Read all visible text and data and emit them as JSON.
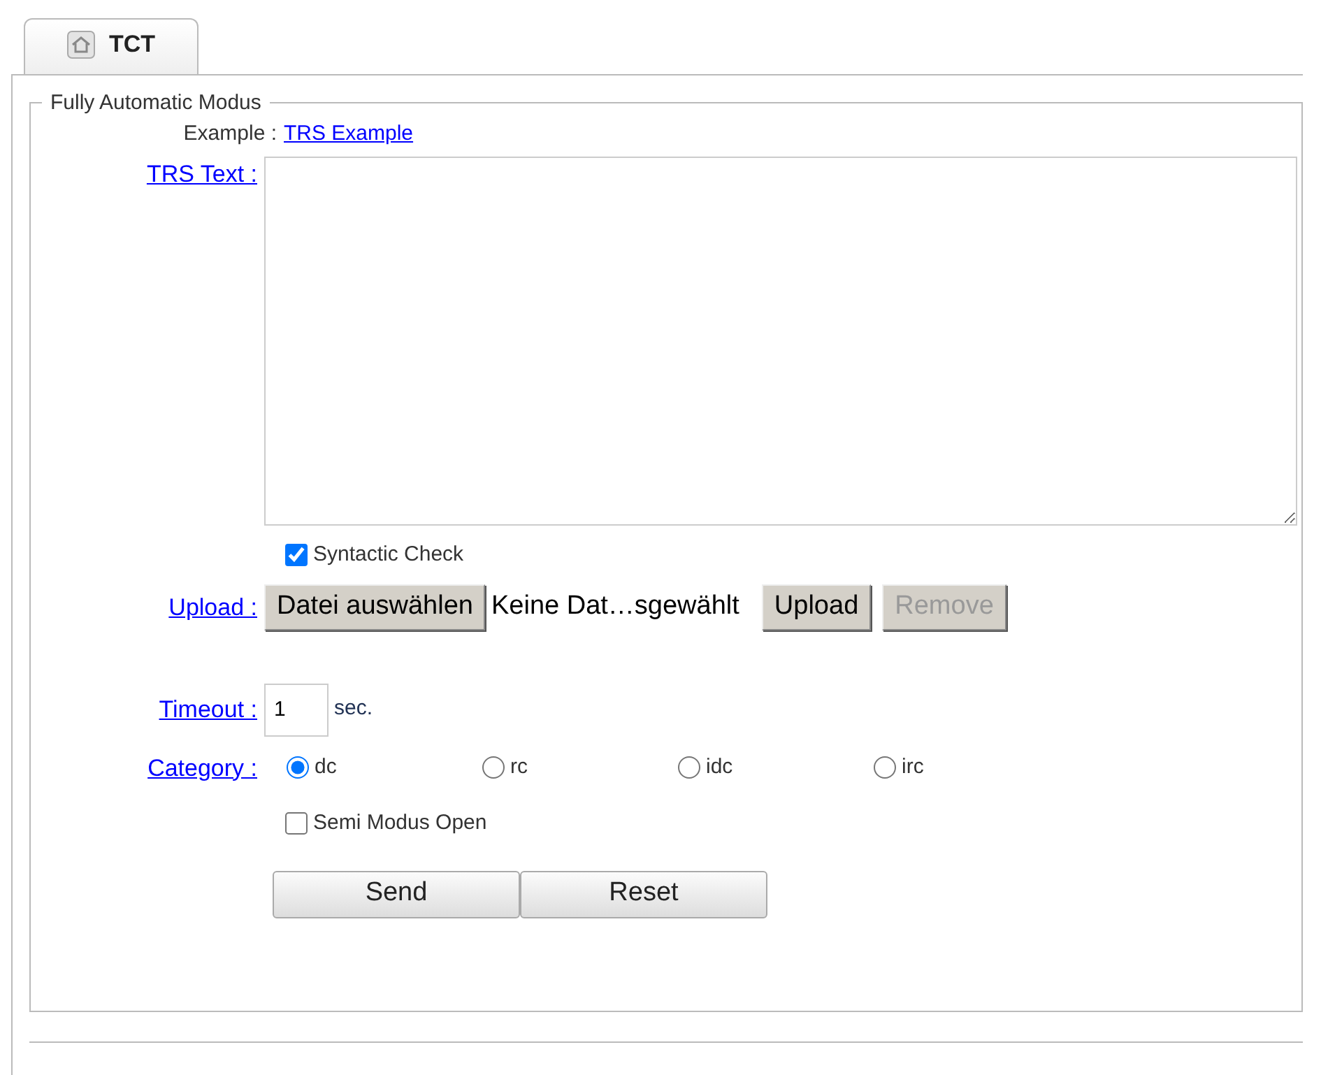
{
  "tabs": [
    {
      "label": "TCT",
      "selected": true
    }
  ],
  "fieldset": {
    "legend": "Fully Automatic Modus"
  },
  "example": {
    "label": "Example :",
    "link": "TRS Example"
  },
  "trs_text": {
    "label": "TRS Text :"
  },
  "syntactic_check": {
    "label": "Syntactic Check",
    "checked": true
  },
  "upload": {
    "label": "Upload :",
    "choose_button": "Datei auswählen",
    "file_status": "Keine Dat…sgewählt",
    "buttons": [
      {
        "label": "Upload",
        "disabled": false
      },
      {
        "label": "Remove",
        "disabled": true
      }
    ]
  },
  "timeout": {
    "label": "Timeout :",
    "value": "1",
    "unit": "sec."
  },
  "category": {
    "label": "Category :",
    "options": [
      {
        "label": "dc",
        "selected": true
      },
      {
        "label": "rc",
        "selected": false
      },
      {
        "label": "idc",
        "selected": false
      },
      {
        "label": "irc",
        "selected": false
      }
    ]
  },
  "semi_modus": {
    "label": "Semi Modus Open",
    "checked": false
  },
  "actions": [
    "Send",
    "Reset"
  ]
}
